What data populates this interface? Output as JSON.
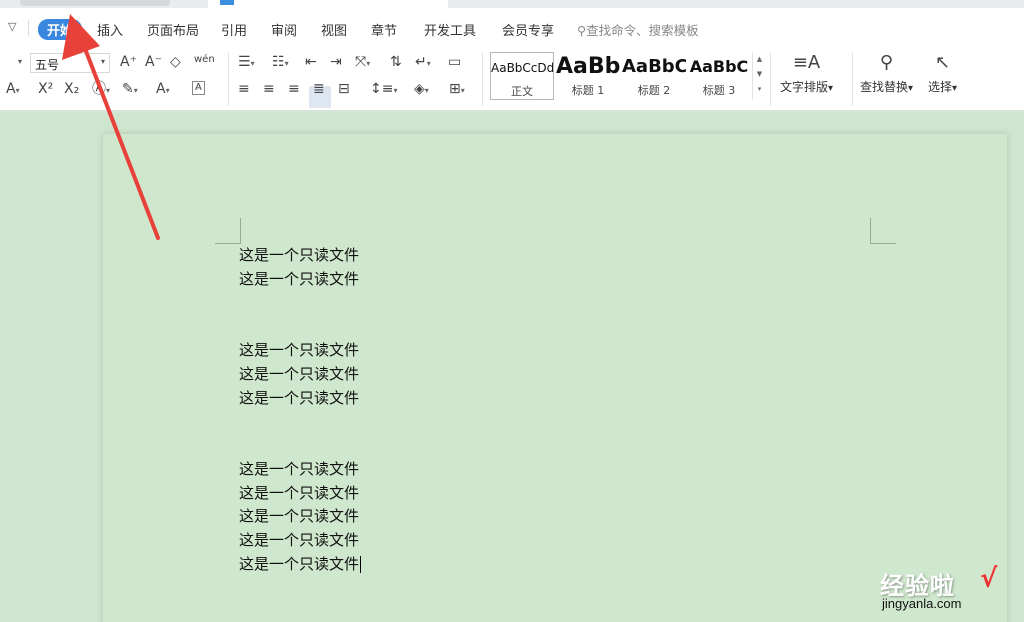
{
  "menu": {
    "tabs": [
      "开始",
      "插入",
      "页面布局",
      "引用",
      "审阅",
      "视图",
      "章节",
      "开发工具",
      "会员专享"
    ],
    "active_tab": "开始",
    "search_placeholder": "查找命令、搜索模板"
  },
  "toolbar": {
    "font_size": "五号",
    "styles": [
      {
        "preview": "AaBbCcDd",
        "label": "正文"
      },
      {
        "preview": "AaBb",
        "label": "标题 1"
      },
      {
        "preview": "AaBbC",
        "label": "标题 2"
      },
      {
        "preview": "AaBbC",
        "label": "标题 3"
      }
    ],
    "text_layout_label": "文字排版",
    "find_replace_label": "查找替换",
    "select_label": "选择",
    "icons": {
      "increase_font": "A⁺",
      "decrease_font": "A⁻",
      "clear_format": "◇",
      "pinyin": "wén",
      "superscript": "X²",
      "subscript": "X₂",
      "text_border": "A"
    }
  },
  "document": {
    "lines": [
      "这是一个只读文件",
      "这是一个只读文件",
      "这是一个只读文件",
      "这是一个只读文件",
      "这是一个只读文件",
      "这是一个只读文件",
      "这是一个只读文件",
      "这是一个只读文件",
      "这是一个只读文件",
      "这是一个只读文件"
    ]
  },
  "watermark": {
    "title": "经验啦",
    "url": "jingyanla.com",
    "check": "√"
  },
  "colors": {
    "accent": "#3a87e0",
    "page_bg": "#cfe6ce",
    "arrow": "#e8413a"
  }
}
